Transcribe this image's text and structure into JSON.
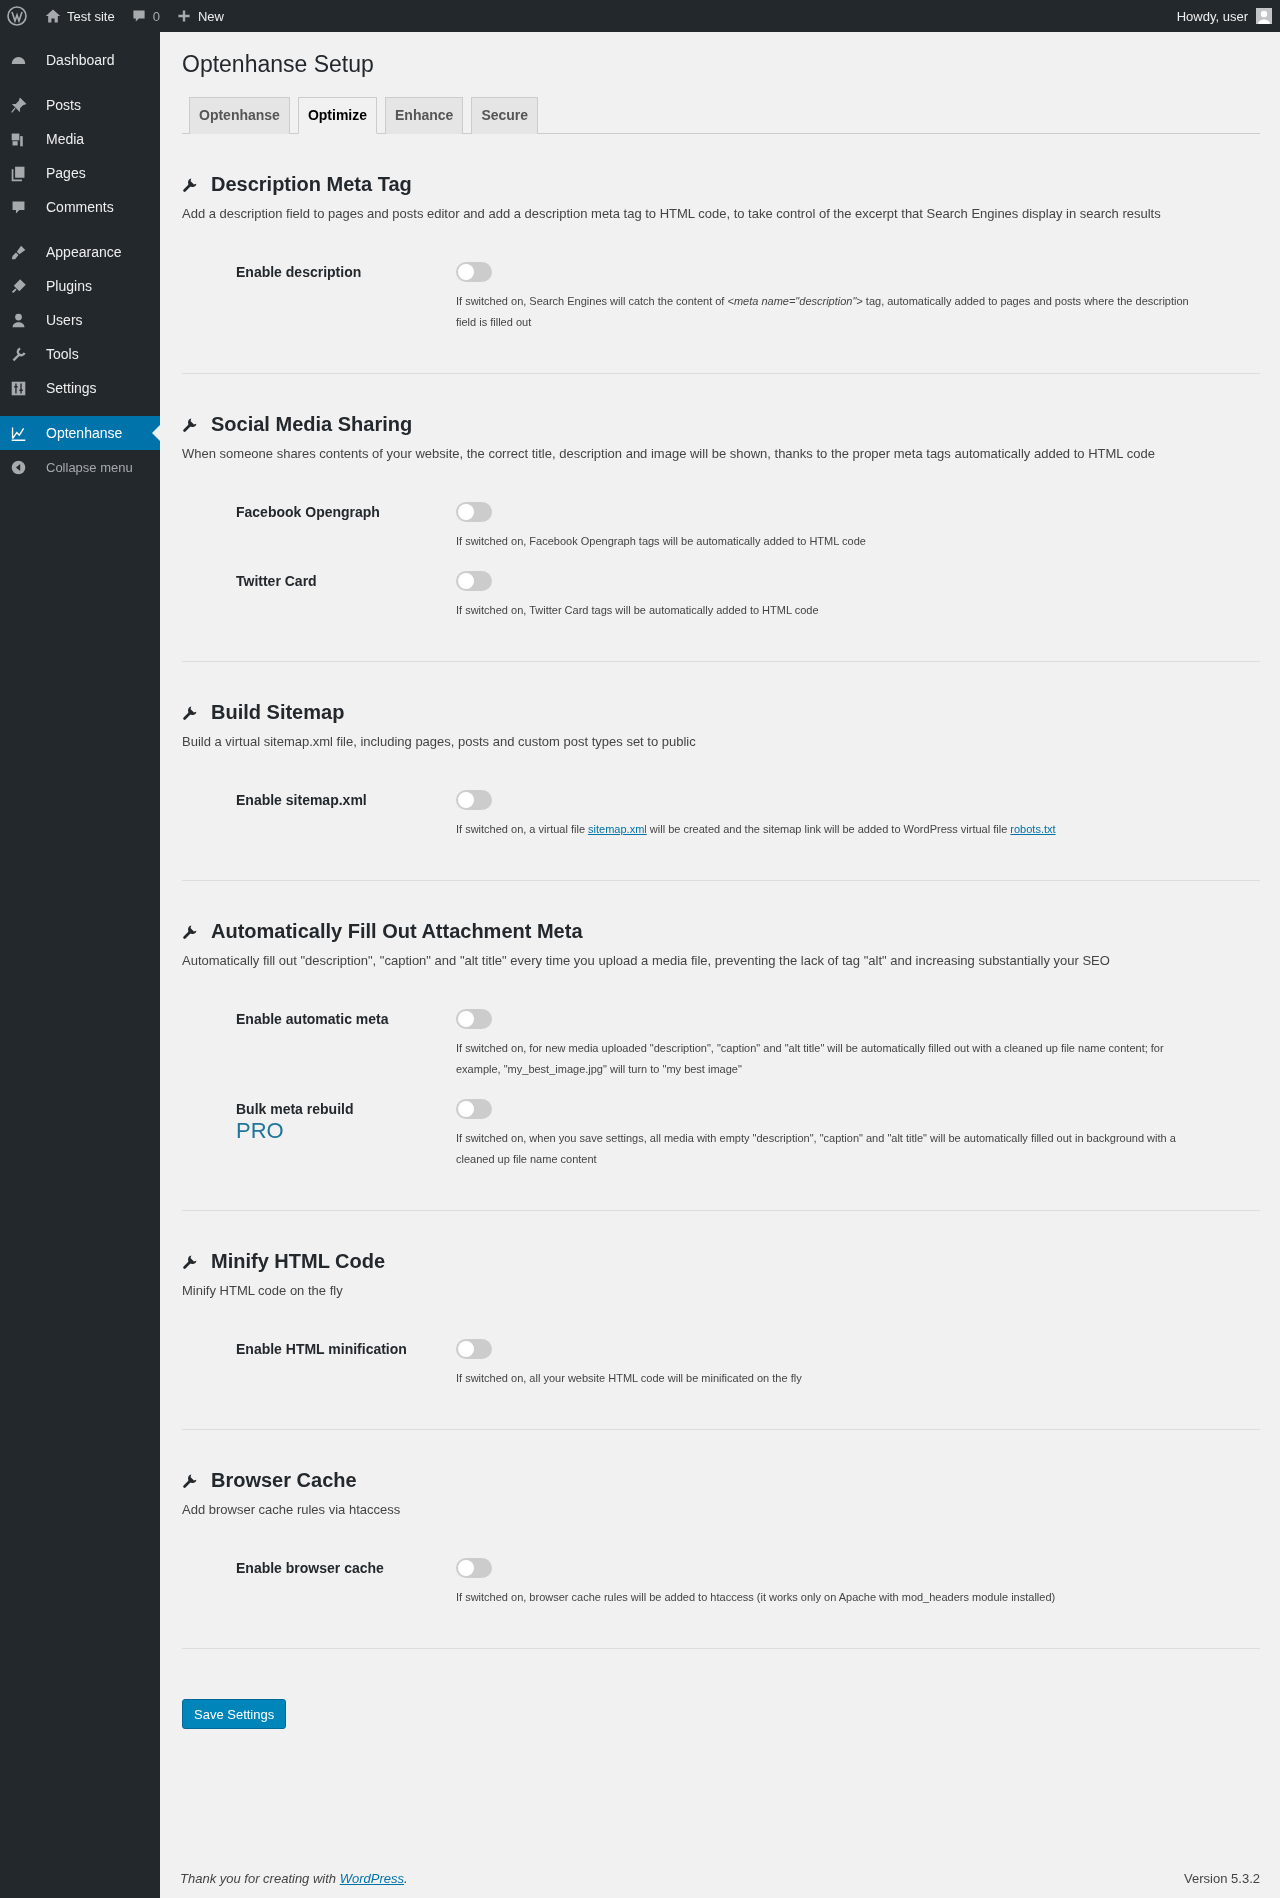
{
  "admin_bar": {
    "site": "Test site",
    "comments": "0",
    "new": "New",
    "greeting": "Howdy, user"
  },
  "sidebar": {
    "groups": [
      [
        {
          "label": "Dashboard",
          "selected": false
        }
      ],
      [
        {
          "label": "Posts",
          "selected": false
        },
        {
          "label": "Media",
          "selected": false
        },
        {
          "label": "Pages",
          "selected": false
        },
        {
          "label": "Comments",
          "selected": false
        }
      ],
      [
        {
          "label": "Appearance",
          "selected": false
        },
        {
          "label": "Plugins",
          "selected": false
        },
        {
          "label": "Users",
          "selected": false
        },
        {
          "label": "Tools",
          "selected": false
        },
        {
          "label": "Settings",
          "selected": false
        }
      ],
      [
        {
          "label": "Optenhanse",
          "selected": true
        }
      ]
    ],
    "collapse": "Collapse menu"
  },
  "page_title": "Optenhanse Setup",
  "tabs": [
    {
      "label": "Optenhanse",
      "selected": false
    },
    {
      "label": "Optimize",
      "selected": true
    },
    {
      "label": "Enhance",
      "selected": false
    },
    {
      "label": "Secure",
      "selected": false
    }
  ],
  "sections": [
    {
      "title": "Description Meta Tag",
      "description": "Add a description field to pages and posts editor and add a description meta tag to HTML code, to take control of the excerpt that Search Engines display in search results",
      "rows": [
        {
          "label": "Enable description",
          "on": false,
          "help": [
            {
              "kind": "text",
              "text": "If switched on, Search Engines will catch the content of *<meta name=\"description\">* tag, automatically added to pages and posts where the description field is filled out"
            }
          ]
        }
      ]
    },
    {
      "title": "Social Media Sharing",
      "description": "When someone shares contents of your website, the correct title, description and image will be shown, thanks to the proper meta tags automatically added to HTML code",
      "rows": [
        {
          "label": "Facebook Opengraph",
          "on": false,
          "help": [
            {
              "kind": "text",
              "text": "If switched on, Facebook Opengraph tags will be automatically added to HTML code"
            }
          ]
        },
        {
          "label": "Twitter Card",
          "on": false,
          "help": [
            {
              "kind": "text",
              "text": "If switched on, Twitter Card tags will be automatically added to HTML code"
            }
          ]
        }
      ]
    },
    {
      "title": "Build Sitemap",
      "description": "Build a virtual sitemap.xml file, including pages, posts and custom post types set to public",
      "rows": [
        {
          "label": "Enable sitemap.xml",
          "on": false,
          "help": [
            {
              "kind": "text",
              "text": "If switched on, a virtual file "
            },
            {
              "kind": "link",
              "text": "sitemap.xml"
            },
            {
              "kind": "text",
              "text": " will be created and the sitemap link will be added to WordPress virtual file "
            },
            {
              "kind": "link",
              "text": "robots.txt"
            }
          ]
        }
      ]
    },
    {
      "title": "Automatically Fill Out Attachment Meta",
      "description": "Automatically fill out \"description\", \"caption\" and \"alt title\" every time you upload a media file, preventing the lack of tag \"alt\" and increasing substantially your SEO",
      "rows": [
        {
          "label": "Enable automatic meta",
          "on": false,
          "help": [
            {
              "kind": "text",
              "text": "If switched on, for new media uploaded \"description\", \"caption\" and \"alt title\" will be automatically filled out with a cleaned up file name content; for example, \"my_best_image.jpg\" will turn to \"my best image\""
            }
          ]
        },
        {
          "label": "Bulk meta rebuild",
          "badge": "PRO",
          "on": false,
          "help": [
            {
              "kind": "text",
              "text": "If switched on, when you save settings, all media with empty \"description\", \"caption\" and \"alt title\" will be automatically filled out in background with a cleaned up file name content"
            }
          ]
        }
      ]
    },
    {
      "title": "Minify HTML Code",
      "description": "Minify HTML code on the fly",
      "rows": [
        {
          "label": "Enable HTML minification",
          "on": false,
          "help": [
            {
              "kind": "text",
              "text": "If switched on, all your website HTML code will be minificated on the fly"
            }
          ]
        }
      ]
    },
    {
      "title": "Browser Cache",
      "description": "Add browser cache rules via htaccess",
      "rows": [
        {
          "label": "Enable browser cache",
          "on": false,
          "help": [
            {
              "kind": "text",
              "text": "If switched on, browser cache rules will be added to htaccess (it works only on Apache with mod_headers module installed)"
            }
          ]
        }
      ]
    }
  ],
  "save_button": "Save Settings",
  "footer": {
    "thanks": "Thank you for creating with ",
    "link": "WordPress",
    "after": ".",
    "version": "Version 5.3.2"
  }
}
